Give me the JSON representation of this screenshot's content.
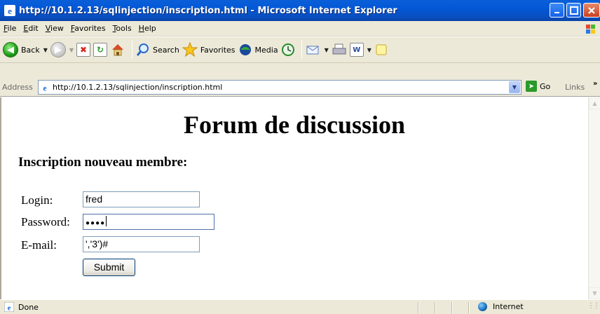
{
  "window": {
    "title": "http://10.1.2.13/sqlinjection/inscription.html - Microsoft Internet Explorer"
  },
  "menu": {
    "items": [
      "File",
      "Edit",
      "View",
      "Favorites",
      "Tools",
      "Help"
    ]
  },
  "toolbar": {
    "back_label": "Back",
    "search_label": "Search",
    "favorites_label": "Favorites",
    "media_label": "Media"
  },
  "address": {
    "label": "Address",
    "url": "http://10.1.2.13/sqlinjection/inscription.html",
    "go_label": "Go",
    "links_label": "Links"
  },
  "page": {
    "heading": "Forum de discussion",
    "form_heading": "Inscription nouveau membre:",
    "login_label": "Login:",
    "login_value": "fred",
    "password_label": "Password:",
    "password_masked": "●●●●",
    "email_label": "E-mail:",
    "email_value": "','3')#",
    "submit_label": "Submit"
  },
  "status": {
    "text": "Done",
    "zone": "Internet"
  },
  "icons": {
    "title": "ie-icon",
    "back": "back-arrow-icon",
    "forward": "forward-arrow-icon",
    "stop": "stop-icon",
    "refresh": "refresh-icon",
    "home": "home-icon",
    "search": "search-icon",
    "favorites": "favorites-star-icon",
    "media": "media-icon",
    "history": "history-icon",
    "mail": "mail-icon",
    "print": "print-icon",
    "edit": "edit-icon",
    "messenger": "messenger-icon",
    "zone": "internet-globe-icon"
  },
  "colors": {
    "titlebar": "#0a5fd8",
    "chrome": "#ece9d8",
    "input_border": "#7f9db9"
  }
}
